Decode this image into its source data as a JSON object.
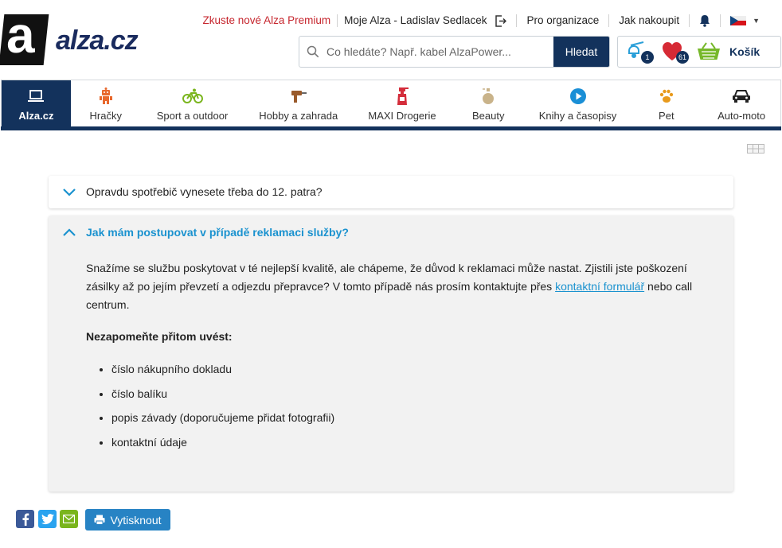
{
  "brand": {
    "logo_letter": "a",
    "logo_text": "alza.cz"
  },
  "topbar": {
    "premium": "Zkuste nové Alza Premium",
    "account": "Moje Alza - Ladislav Sedlacek",
    "organizations": "Pro organizace",
    "how_to_buy": "Jak nakoupit",
    "language_flag": "cz-flag-icon"
  },
  "search": {
    "placeholder": "Co hledáte? Např. kabel AlzaPower...",
    "button": "Hledat"
  },
  "cart": {
    "watchdog_count": "1",
    "favorites_count": "61",
    "label": "Košík"
  },
  "nav": {
    "items": [
      {
        "label": "Alza.cz",
        "icon": "laptop-icon"
      },
      {
        "label": "Hračky",
        "icon": "robot-icon"
      },
      {
        "label": "Sport a outdoor",
        "icon": "bicycle-icon"
      },
      {
        "label": "Hobby a zahrada",
        "icon": "drill-icon"
      },
      {
        "label": "MAXI Drogerie",
        "icon": "spray-bottle-icon"
      },
      {
        "label": "Beauty",
        "icon": "perfume-icon"
      },
      {
        "label": "Knihy a časopisy",
        "icon": "play-icon"
      },
      {
        "label": "Pet",
        "icon": "paw-icon"
      },
      {
        "label": "Auto-moto",
        "icon": "car-icon"
      }
    ]
  },
  "faq": {
    "q1": "Opravdu spotřebič vynesete třeba do 12. patra?",
    "q2": "Jak mám postupovat v případě reklamaci služby?",
    "answer_p1_before": "Snažíme se službu poskytovat v té nejlepší kvalitě, ale chápeme, že důvod k reklamaci může nastat. Zjistili jste poškození zásilky až po jejím převzetí a odjezdu přepravce? V tomto případě nás prosím kontaktujte přes ",
    "answer_link": "kontaktní formulář",
    "answer_p1_after": " nebo call centrum.",
    "reminder_heading": "Nezapomeňte přitom uvést:",
    "list": [
      "číslo nákupního dokladu",
      "číslo balíku",
      "popis závady (doporučujeme přidat fotografii)",
      "kontaktní údaje"
    ]
  },
  "tools": {
    "print": "Vytisknout"
  },
  "colors": {
    "navy": "#13325c",
    "link": "#1a92cf",
    "premium_red": "#c6262e",
    "print_blue": "#2783c4"
  }
}
